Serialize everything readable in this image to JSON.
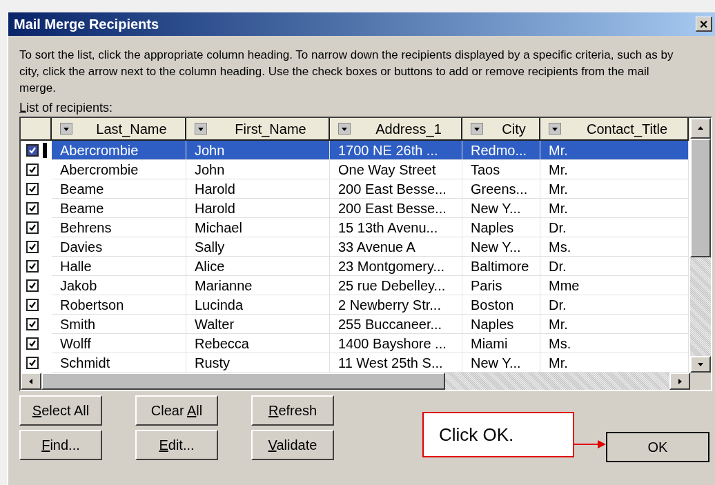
{
  "window": {
    "title": "Mail Merge Recipients",
    "close": "×"
  },
  "instructions": "To sort the list, click the appropriate column heading.  To narrow down the recipients displayed by a specific criteria, such as by city, click the arrow next to the column heading.  Use the check boxes or buttons to add or remove recipients from the mail merge.",
  "list_label": {
    "key": "L",
    "post": "ist of recipients:"
  },
  "table": {
    "columns": [
      "Last_Name",
      "First_Name",
      "Address_1",
      "City",
      "Contact_Title"
    ],
    "rows": [
      {
        "checked": true,
        "selected": true,
        "cells": [
          "Abercrombie",
          "John",
          "1700 NE 26th ...",
          "Redmo...",
          "Mr."
        ]
      },
      {
        "checked": true,
        "selected": false,
        "cells": [
          "Abercrombie",
          "John",
          "One Way Street",
          "Taos",
          "Mr."
        ]
      },
      {
        "checked": true,
        "selected": false,
        "cells": [
          "Beame",
          "Harold",
          "200 East Besse...",
          "Greens...",
          "Mr."
        ]
      },
      {
        "checked": true,
        "selected": false,
        "cells": [
          "Beame",
          "Harold",
          "200 East Besse...",
          "New Y...",
          "Mr."
        ]
      },
      {
        "checked": true,
        "selected": false,
        "cells": [
          "Behrens",
          "Michael",
          "15 13th Avenu...",
          "Naples",
          "Dr."
        ]
      },
      {
        "checked": true,
        "selected": false,
        "cells": [
          "Davies",
          "Sally",
          "33 Avenue A",
          "New Y...",
          "Ms."
        ]
      },
      {
        "checked": true,
        "selected": false,
        "cells": [
          "Halle",
          "Alice",
          "23 Montgomery...",
          "Baltimore",
          "Dr."
        ]
      },
      {
        "checked": true,
        "selected": false,
        "cells": [
          "Jakob",
          "Marianne",
          "25 rue Debelley...",
          "Paris",
          "Mme"
        ]
      },
      {
        "checked": true,
        "selected": false,
        "cells": [
          "Robertson",
          "Lucinda",
          "2 Newberry Str...",
          "Boston",
          "Dr."
        ]
      },
      {
        "checked": true,
        "selected": false,
        "cells": [
          "Smith",
          "Walter",
          "255 Buccaneer...",
          "Naples",
          "Mr."
        ]
      },
      {
        "checked": true,
        "selected": false,
        "cells": [
          "Wolff",
          "Rebecca",
          "1400 Bayshore ...",
          "Miami",
          "Ms."
        ]
      },
      {
        "checked": true,
        "selected": false,
        "cells": [
          "Schmidt",
          "Rusty",
          "11 West 25th S...",
          "New Y...",
          "Mr."
        ]
      }
    ]
  },
  "buttons": [
    {
      "key": "S",
      "post": "elect All"
    },
    {
      "pre": "Clear ",
      "key": "A",
      "post": "ll"
    },
    {
      "key": "R",
      "post": "efresh"
    },
    {
      "key": "F",
      "post": "ind..."
    },
    {
      "key": "E",
      "post": "dit..."
    },
    {
      "key": "V",
      "post": "alidate"
    }
  ],
  "callout": "Click OK.",
  "ok_button": "OK"
}
